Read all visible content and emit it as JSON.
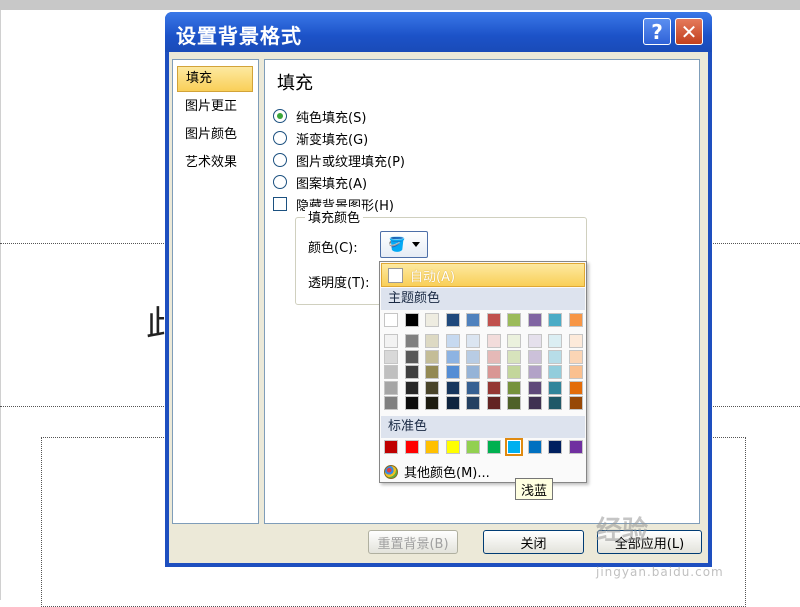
{
  "dialog": {
    "title": "设置背景格式",
    "help_glyph": "?",
    "close_glyph": "✕"
  },
  "nav": {
    "items": [
      {
        "label": "填充",
        "selected": true
      },
      {
        "label": "图片更正"
      },
      {
        "label": "图片颜色"
      },
      {
        "label": "艺术效果"
      }
    ]
  },
  "fill": {
    "section_title": "填充",
    "options": [
      {
        "label": "纯色填充(S)",
        "checked": true
      },
      {
        "label": "渐变填充(G)"
      },
      {
        "label": "图片或纹理填充(P)"
      },
      {
        "label": "图案填充(A)"
      }
    ],
    "hide_bg_label": "隐藏背景图形(H)",
    "group_title": "填充颜色",
    "color_label": "颜色(C):",
    "transparency_label": "透明度(T):"
  },
  "footer": {
    "reset_label": "重置背景(B)",
    "close_label": "关闭",
    "apply_all_label": "全部应用(L)"
  },
  "dropdown": {
    "auto_label": "自动(A)",
    "theme_header": "主题颜色",
    "standard_header": "标准色",
    "other_colors_label": "其他颜色(M)...",
    "theme_top": [
      "#ffffff",
      "#000000",
      "#eeece1",
      "#1f497d",
      "#4f81bd",
      "#c0504d",
      "#9bbb59",
      "#8064a2",
      "#4bacc6",
      "#f79646"
    ],
    "theme_shades": [
      [
        "#f2f2f2",
        "#7f7f7f",
        "#ddd9c3",
        "#c6d9f0",
        "#dbe5f1",
        "#f2dcdb",
        "#ebf1dd",
        "#e5e0ec",
        "#dbeef3",
        "#fdeada"
      ],
      [
        "#d8d8d8",
        "#595959",
        "#c4bd97",
        "#8db3e2",
        "#b8cce4",
        "#e5b9b7",
        "#d7e3bc",
        "#ccc1d9",
        "#b7dde8",
        "#fbd5b5"
      ],
      [
        "#bfbfbf",
        "#3f3f3f",
        "#938953",
        "#548dd4",
        "#95b3d7",
        "#d99694",
        "#c3d69b",
        "#b2a2c7",
        "#92cddc",
        "#fac08f"
      ],
      [
        "#a5a5a5",
        "#262626",
        "#494429",
        "#17365d",
        "#366092",
        "#953734",
        "#76923c",
        "#5f497a",
        "#31859b",
        "#e36c09"
      ],
      [
        "#7f7f7f",
        "#0c0c0c",
        "#1d1b10",
        "#0f243e",
        "#244061",
        "#632423",
        "#4f6128",
        "#3f3151",
        "#205867",
        "#974806"
      ]
    ],
    "standard": [
      "#c00000",
      "#ff0000",
      "#ffc000",
      "#ffff00",
      "#92d050",
      "#00b050",
      "#00b0f0",
      "#0070c0",
      "#002060",
      "#7030a0"
    ],
    "highlighted_standard_index": 6
  },
  "tooltip": "浅蓝",
  "watermark": {
    "text": "经验",
    "url": "jingyan.baidu.com"
  },
  "slide": {
    "glyph": "此"
  }
}
